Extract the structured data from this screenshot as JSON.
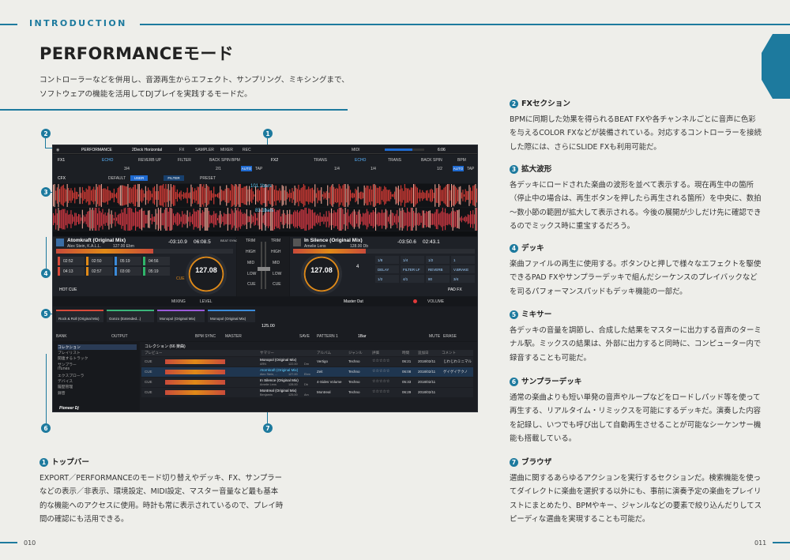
{
  "header": {
    "section_label": "INTRODUCTION",
    "title": "PERFORMANCEモード"
  },
  "lead": "コントローラーなどを併用し、音源再生からエフェクト、サンプリング、ミキシングまで、ソフトウェアの機能を活用してDJプレイを実践するモードだ。",
  "sections": [
    {
      "num": "1",
      "title": "トップバー",
      "body": "EXPORT／PERFORMANCEのモード切り替えやデッキ、FX、サンプラーなどの表示／非表示、環境設定、MIDI設定、マスター音量など最も基本的な機能へのアクセスに使用。時計も常に表示されているので、プレイ時間の確認にも活用できる。"
    },
    {
      "num": "2",
      "title": "FXセクション",
      "body": "BPMに同期した効果を得られるBEAT FXや各チャンネルごとに音声に色彩を与えるCOLOR FXなどが装備されている。対応するコントローラーを接続した際には、さらにSLIDE FXも利用可能だ。"
    },
    {
      "num": "3",
      "title": "拡大波形",
      "body": "各デッキにロードされた楽曲の波形を並べて表示する。現在再生中の箇所（停止中の場合は、再生ボタンを押したら再生される箇所）を中央に、数拍～数小節の範囲が拡大して表示される。今後の展開が少しだけ先に確認できるのでミックス時に重宝するだろう。"
    },
    {
      "num": "4",
      "title": "デッキ",
      "body": "楽曲ファイルの再生に使用する。ボタンひと押しで様々なエフェクトを駆使できるPAD FXやサンプラーデッキで組んだシーケンスのプレイバックなどを司るパフォーマンスパッドもデッキ機能の一部だ。"
    },
    {
      "num": "5",
      "title": "ミキサー",
      "body": "各デッキの音量を調節し、合成した結果をマスターに出力する音声のターミナル駅。ミックスの結果は、外部に出力すると同時に、コンピューター内で録音することも可能だ。"
    },
    {
      "num": "6",
      "title": "サンプラーデッキ",
      "body": "通常の楽曲よりも短い単発の音声やループなどをロードしパッド等を使って再生する、リアルタイム・リミックスを可能にするデッキだ。演奏した内容を記録し、いつでも呼び出して自動再生させることが可能なシーケンサー機能も搭載している。"
    },
    {
      "num": "7",
      "title": "ブラウザ",
      "body": "選曲に関するあらゆるアクションを実行するセクションだ。検索機能を使ってダイレクトに楽曲を選択する以外にも、事前に演奏予定の楽曲をプレイリストにまとめたり、BPMやキー、ジャンルなどの要素で絞り込んだりしてスピーディな選曲を実現することも可能だ。"
    }
  ],
  "callouts": [
    "2",
    "1",
    "3",
    "4",
    "5",
    "6",
    "7"
  ],
  "pages": {
    "left": "010",
    "right": "011"
  },
  "colors": {
    "accent": "#1d7a9e",
    "waveform_red": "#e8403a",
    "deck_orange": "#e08a18",
    "ui_blue": "#1f6ad0"
  },
  "screenshot": {
    "topbar": {
      "mode": "PERFORMANCE",
      "layout": "2Deck Horizontal",
      "fx": "FX",
      "sampler": "SAMPLER",
      "mixer": "MIXER",
      "rec": "REC",
      "midi": "MIDI",
      "clock": "6:06"
    },
    "fx": {
      "fx1": "FX1",
      "fx2": "FX2",
      "echo": "ECHO",
      "reverb": "REVERB UP",
      "filter": "FILTER",
      "backspin": "BACK SPIN",
      "trans": "TRANS",
      "bpm": "BPM",
      "auto": "AUTO",
      "tap": "TAP",
      "cfx": "CFX",
      "default": "DEFAULT",
      "user": "USER",
      "filter2": "FILTER",
      "pitch": "PRESET",
      "beat_a": "3/4",
      "beat_b": "2/1",
      "beat_c": "1/4",
      "beat_d": "1/4",
      "beat_e": "1/2"
    },
    "wave": {
      "label1": "101.1bars",
      "label2": "83.1bars"
    },
    "deck1": {
      "title": "Atomkraft (Original Mix)",
      "artist": "Alex Stein, K.A.L.L.",
      "tempo": "127.00 Ebm",
      "elapsed": "-03:10.9",
      "remain": "06:08.5",
      "bpm": "127.08",
      "pitch": "127.08",
      "sync": "SYNC",
      "beat_sync": "BEAT SYNC",
      "hotcue": "HOT CUE",
      "cue": "CUE",
      "pads": [
        "02:52",
        "02:50",
        "05:19",
        "04:56",
        "04:13",
        "02:57",
        "03:00",
        "05:19"
      ]
    },
    "deck2": {
      "title": "In Silence (Original Mix)",
      "artist": "Amelie Lens",
      "tempo": "128.00 Db",
      "elapsed": "-03:50.6",
      "remain": "02:43.1",
      "bpm": "127.08",
      "loop": "4",
      "slip": "SLIP LOOP",
      "padfx": "PAD FX",
      "pads": [
        "1/8",
        "1/4",
        "1/2",
        "1",
        "DELAY",
        "FILTER LF",
        "REVERB",
        "V.BRAKE",
        "1/2",
        "4/1",
        "80",
        "3/4"
      ]
    },
    "mixer": {
      "trim": "TRIM",
      "hi": "HIGH",
      "mid": "MID",
      "low": "LOW",
      "cue": "CUE",
      "master_out": "Master Out",
      "volume": "VOLUME",
      "level": "LEVEL",
      "mixing": "MIXING"
    },
    "sampler": {
      "slots": [
        "Rock & Roll (Original Mix)",
        "Gonzo (Extended...)",
        "Monopol (Original Mix)",
        "Monopol (Original Mix)"
      ],
      "bank": "BANK",
      "output": "OUTPUT",
      "bpm_sync": "BPM SYNC",
      "master": "MASTER",
      "bpm": "125.00",
      "save": "SAVE",
      "pattern": "PATTERN 1",
      "bar": "1Bar",
      "mute": "MUTE",
      "erase": "ERASE"
    },
    "browser": {
      "collection": "コレクション (66 楽曲)",
      "tree": [
        "コレクション",
        "プレイリスト",
        "関連するトラック",
        "サンプラー",
        "iTunes",
        "エクスプローラ",
        "デバイス",
        "履歴管理",
        "録音"
      ],
      "columns": [
        "プレビュー",
        "",
        "サマリー",
        "アルバム",
        "ジャンル",
        "評価",
        "時間",
        "追加日",
        "コメント"
      ],
      "rows": [
        {
          "title": "Monopol (Original Mix)",
          "artist": "ARN",
          "bpm": "122.00",
          "key": "Dm",
          "album": "Vertigo",
          "genre": "Techno",
          "rating": "☆☆☆☆☆",
          "time": "06:21",
          "date": "2018/02/11",
          "comment": "じわじわミニマル"
        },
        {
          "title": "Atomkraft (Original Mix)",
          "artist": "Alex Stein, ...",
          "bpm": "127.00",
          "key": "Ebm",
          "album": "Zeit",
          "genre": "Techno",
          "rating": "☆☆☆☆☆",
          "time": "06:08",
          "date": "2018/02/11",
          "comment": "ゲイゲイテクノ"
        },
        {
          "title": "In Silence (Original Mix)",
          "artist": "Amelie Lens",
          "bpm": "128.00",
          "key": "Db",
          "album": "4-Sides Volume",
          "genre": "Techno",
          "rating": "☆☆☆☆☆",
          "time": "05:33",
          "date": "2018/02/11",
          "comment": ""
        },
        {
          "title": "Montreal (Original Mix)",
          "artist": "Benjamin",
          "bpm": "125.00",
          "key": "Am",
          "album": "Montreal",
          "genre": "Techno",
          "rating": "☆☆☆☆☆",
          "time": "06:29",
          "date": "2018/02/11",
          "comment": ""
        }
      ],
      "cue": "CUE",
      "brand": "Pioneer Dj"
    }
  }
}
